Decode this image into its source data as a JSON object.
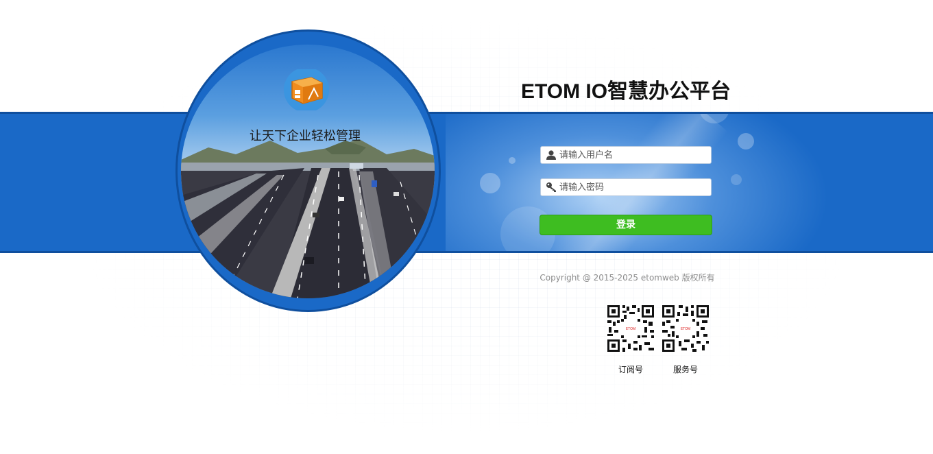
{
  "slogan": "让天下企业轻松管理",
  "title": "ETOM IO智慧办公平台",
  "form": {
    "username_placeholder": "请输入用户名",
    "username_value": "",
    "password_placeholder": "请输入密码",
    "password_value": "",
    "login_label": "登录"
  },
  "footer": {
    "copyright": "Copyright @ 2015-2025 etomweb 版权所有",
    "qr_codes": [
      {
        "label": "订阅号",
        "inner_text": "ETOM"
      },
      {
        "label": "服务号",
        "inner_text": "ETOM"
      }
    ]
  },
  "icons": {
    "username": "user-icon",
    "password": "key-icon",
    "logo": "box-logo-icon"
  },
  "colors": {
    "band": "#1a69c7",
    "login_button": "#3ebd21",
    "logo": "#f08c1e"
  }
}
